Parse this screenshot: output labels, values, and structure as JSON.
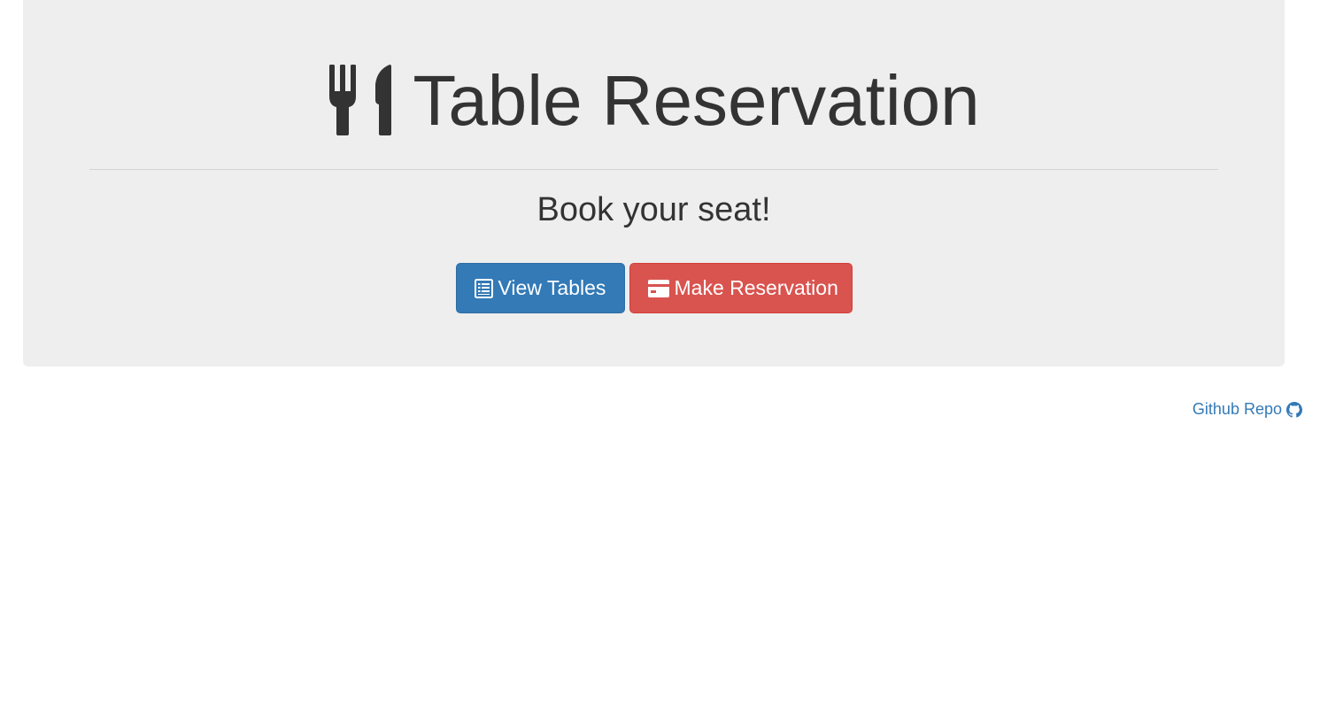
{
  "jumbotron": {
    "title": "Table Reservation",
    "title_icon": "cutlery-icon",
    "subtitle": "Book your seat!"
  },
  "buttons": {
    "view_tables": {
      "label": "View Tables",
      "icon": "list-alt-icon",
      "color": "#337ab7"
    },
    "make_reservation": {
      "label": "Make Reservation",
      "icon": "credit-card-icon",
      "color": "#d9534f"
    }
  },
  "footer": {
    "github_label": "Github Repo",
    "github_icon": "github-icon",
    "link_color": "#337ab7"
  }
}
